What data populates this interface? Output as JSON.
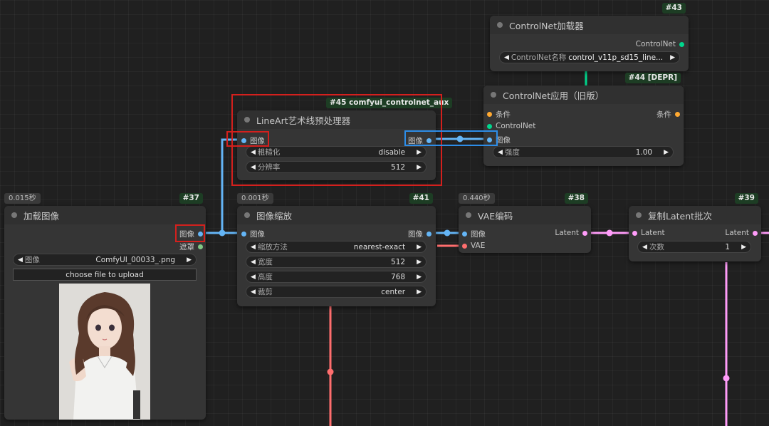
{
  "colors": {
    "image_link": "#64b5f6",
    "latent_link": "#ff9cf9",
    "vae_link": "#ff6e6e",
    "controlnet_link": "#00d78d",
    "conditioning": "#ffa931",
    "mask": "#81c784",
    "highlight_red": "#d4201d",
    "highlight_blue": "#2d8de8"
  },
  "nodes": {
    "load_image": {
      "id": "#37",
      "time": "0.015秒",
      "title": "加载图像",
      "out_image": "图像",
      "out_mask": "遮罩",
      "w_image_label": "图像",
      "w_image_value": "ComfyUI_00033_.png",
      "upload_label": "choose file to upload"
    },
    "lineart": {
      "id": "#45 comfyui_controlnet_aux",
      "title": "LineArt艺术线预处理器",
      "in_image": "图像",
      "out_image": "图像",
      "w1_label": "粗糙化",
      "w1_value": "disable",
      "w2_label": "分辨率",
      "w2_value": "512"
    },
    "cn_loader": {
      "id": "#43",
      "title": "ControlNet加载器",
      "out": "ControlNet",
      "w_label": "ControlNet名称",
      "w_value": "control_v11p_sd15_line..."
    },
    "cn_apply": {
      "id": "#44 [DEPR]",
      "title": "ControlNet应用（旧版）",
      "in_cond": "条件",
      "in_cn": "ControlNet",
      "in_image": "图像",
      "out_cond": "条件",
      "w_label": "强度",
      "w_value": "1.00"
    },
    "scale": {
      "id": "#41",
      "time": "0.001秒",
      "title": "图像缩放",
      "in_image": "图像",
      "out_image": "图像",
      "w1_label": "缩放方法",
      "w1_value": "nearest-exact",
      "w2_label": "宽度",
      "w2_value": "512",
      "w3_label": "高度",
      "w3_value": "768",
      "w4_label": "裁剪",
      "w4_value": "center"
    },
    "vae_encode": {
      "id": "#38",
      "time": "0.440秒",
      "title": "VAE编码",
      "in_image": "图像",
      "in_vae": "VAE",
      "out": "Latent"
    },
    "repeat_latent": {
      "id": "#39",
      "title": "复制Latent批次",
      "in": "Latent",
      "out": "Latent",
      "w_label": "次数",
      "w_value": "1"
    }
  }
}
